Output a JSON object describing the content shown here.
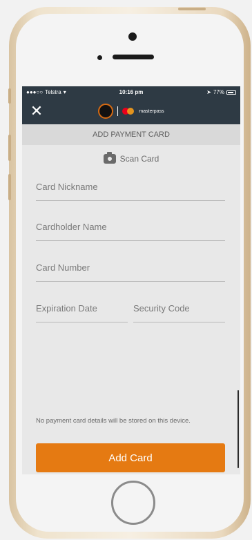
{
  "status": {
    "carrier": "Telstra",
    "time": "10:16 pm",
    "battery": "77%"
  },
  "nav": {
    "brand_word": "masterpass"
  },
  "header": {
    "title": "ADD PAYMENT CARD"
  },
  "scan": {
    "label": "Scan Card"
  },
  "form": {
    "nickname_placeholder": "Card Nickname",
    "cardholder_placeholder": "Cardholder Name",
    "number_placeholder": "Card Number",
    "expiration_placeholder": "Expiration Date",
    "security_placeholder": "Security Code"
  },
  "notice": {
    "text": "No payment card details will be stored on this device."
  },
  "actions": {
    "add_card_label": "Add Card"
  },
  "colors": {
    "nav_bg": "#2e3a44",
    "accent_orange": "#e57a12"
  }
}
